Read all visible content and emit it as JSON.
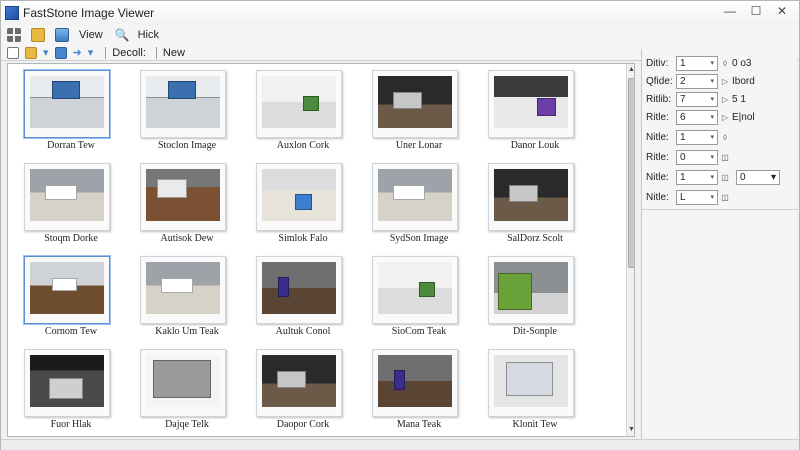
{
  "window": {
    "title": "FastStone Image Viewer",
    "controls": {
      "minimize": "—",
      "maximize": "☐",
      "close": "✕"
    }
  },
  "menubar": {
    "items": [
      {
        "label": "View"
      },
      {
        "label": "Hick"
      }
    ]
  },
  "toolbar": {
    "labels": [
      "Decoll:",
      "New"
    ]
  },
  "thumbnails": [
    {
      "caption": "Dorran Tew",
      "scene": "desk-monitor",
      "selected": true
    },
    {
      "caption": "Stoclon Image",
      "scene": "desk-monitor"
    },
    {
      "caption": "Auxlon Cork",
      "scene": "desk-laptop"
    },
    {
      "caption": "Uner Lonar",
      "scene": "dark-desk"
    },
    {
      "caption": "Danor Louk",
      "scene": "desk-purple"
    },
    {
      "caption": "Stoqm Dorke",
      "scene": "office-room"
    },
    {
      "caption": "Autisok Dew",
      "scene": "printer-desk"
    },
    {
      "caption": "Simlok Falo",
      "scene": "laptop-blue"
    },
    {
      "caption": "SydSon Image",
      "scene": "office-room"
    },
    {
      "caption": "SalDorz Scolt",
      "scene": "dark-desk"
    },
    {
      "caption": "Cornom Tew",
      "scene": "grey-desk",
      "selected": true
    },
    {
      "caption": "Kaklo Um Teak",
      "scene": "office-room"
    },
    {
      "caption": "Aultuk Conol",
      "scene": "purple-room"
    },
    {
      "caption": "SioCom Teak",
      "scene": "desk-laptop"
    },
    {
      "caption": "Dit-Sonple",
      "scene": "green-box"
    },
    {
      "caption": "Fuor Hlak",
      "scene": "monitor-dark"
    },
    {
      "caption": "Dajqe Telk",
      "scene": "document"
    },
    {
      "caption": "Daopor Cork",
      "scene": "dark-desk"
    },
    {
      "caption": "Mana Teak",
      "scene": "purple-room"
    },
    {
      "caption": "Klonit Tew",
      "scene": "monitor-screen"
    }
  ],
  "properties": {
    "rows": [
      {
        "label": "Ditiv:",
        "select": "1",
        "arrow": "◊",
        "value": "0 o3"
      },
      {
        "label": "Qfide:",
        "select": "2",
        "arrow": "▷",
        "value": "Ibord"
      },
      {
        "label": "Ritlib:",
        "select": "7",
        "arrow": "▷",
        "value": "5 1"
      },
      {
        "label": "Ritle:",
        "select": "6",
        "arrow": "▷",
        "value": "E|nol"
      },
      {
        "label": "Nitle:",
        "select": "1",
        "arrow": "◊",
        "value": ""
      },
      {
        "label": "Ritle:",
        "select": "0",
        "arrow": "◫",
        "value": ""
      },
      {
        "label": "Nitle:",
        "select": "1",
        "arrow": "◫",
        "value": "",
        "extra_select": "0"
      },
      {
        "label": "Nitle:",
        "select": "L",
        "arrow": "◫",
        "value": ""
      }
    ]
  }
}
